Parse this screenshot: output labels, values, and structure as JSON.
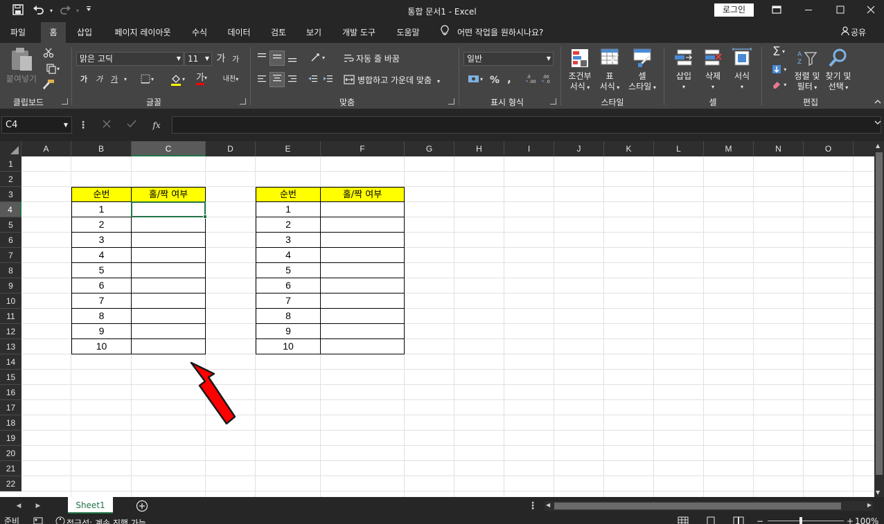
{
  "app": {
    "document_title": "통합 문서1  -  Excel",
    "login_label": "로그인"
  },
  "quick_access": {
    "save_icon": "save-icon",
    "undo_icon": "undo-icon",
    "redo_icon": "redo-icon",
    "customize_icon": "customize-qat-icon"
  },
  "menu": {
    "tabs": [
      "파일",
      "홈",
      "삽입",
      "페이지 레이아웃",
      "수식",
      "데이터",
      "검토",
      "보기",
      "개발 도구",
      "도움말"
    ],
    "active_tab": "홈",
    "tell_me": "어떤 작업을 원하시나요?",
    "share": "공유"
  },
  "ribbon": {
    "clipboard": {
      "label": "클립보드",
      "paste": "붙여넣기"
    },
    "font": {
      "label": "글꼴",
      "font_name": "맑은 고딕",
      "font_size": "11",
      "grow": "가",
      "shrink": "가",
      "bold": "가",
      "italic": "가",
      "underline": "가",
      "font_color_glyph": "가",
      "phonetic": "내천"
    },
    "alignment": {
      "label": "맞춤",
      "wrap_text": "자동 줄 바꿈",
      "merge_center": "병합하고 가운데 맞춤"
    },
    "number": {
      "label": "표시 형식",
      "format": "일반",
      "percent": "%",
      "comma": ","
    },
    "styles": {
      "label": "스타일",
      "conditional_line1": "조건부",
      "conditional_line2": "서식",
      "table_line1": "표",
      "table_line2": "서식",
      "cell_styles_line1": "셀",
      "cell_styles_line2": "스타일"
    },
    "cells": {
      "label": "셀",
      "insert": "삽입",
      "delete": "삭제",
      "format": "서식"
    },
    "editing": {
      "label": "편집",
      "sort_line1": "정렬 및",
      "sort_line2": "필터",
      "find_line1": "찾기 및",
      "find_line2": "선택"
    }
  },
  "formula_bar": {
    "name_box": "C4",
    "fx": "fx",
    "formula": ""
  },
  "grid": {
    "columns": [
      "A",
      "B",
      "C",
      "D",
      "E",
      "F",
      "G",
      "H",
      "I",
      "J",
      "K",
      "L",
      "M",
      "N",
      "O"
    ],
    "rows": [
      "1",
      "2",
      "3",
      "4",
      "5",
      "6",
      "7",
      "8",
      "9",
      "10",
      "11",
      "12",
      "13",
      "14",
      "15",
      "16",
      "17",
      "18",
      "19",
      "20",
      "21",
      "22"
    ],
    "selected_column": "C",
    "selected_row": "4",
    "table1": {
      "headers": [
        "순번",
        "홀/짝 여부"
      ],
      "numbers": [
        "1",
        "2",
        "3",
        "4",
        "5",
        "6",
        "7",
        "8",
        "9",
        "10"
      ]
    },
    "table2": {
      "headers": [
        "순번",
        "홀/짝 여부"
      ],
      "numbers": [
        "1",
        "2",
        "3",
        "4",
        "5",
        "6",
        "7",
        "8",
        "9",
        "10"
      ]
    },
    "header_fill": "#ffff00",
    "arrow_color": "#ff0000"
  },
  "sheets": {
    "tabs": [
      "Sheet1"
    ],
    "active": "Sheet1"
  },
  "status": {
    "ready": "준비",
    "accessibility": "접근성: 계속 진행 가능",
    "zoom": "100%"
  }
}
